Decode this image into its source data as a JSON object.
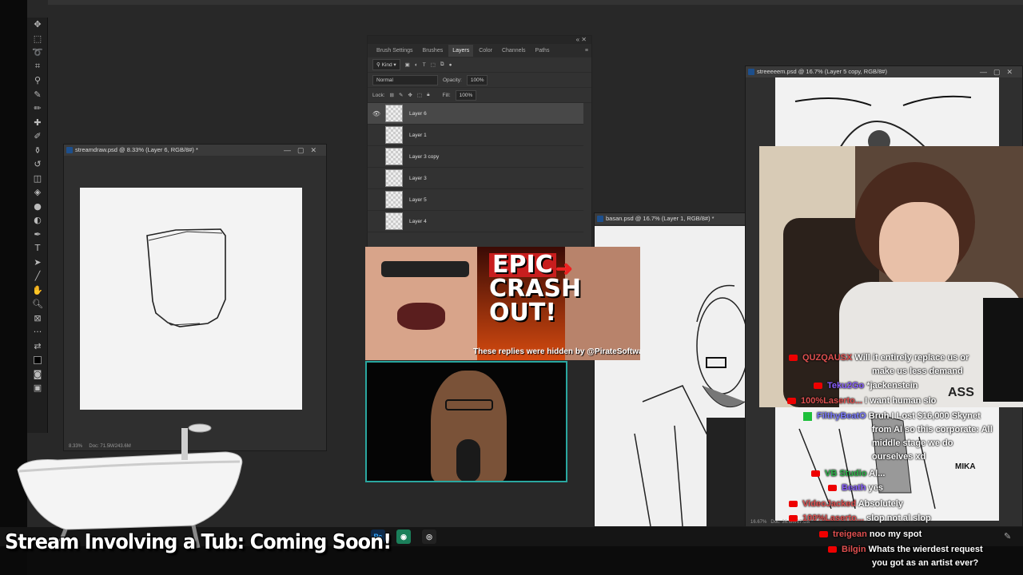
{
  "docs": {
    "left": {
      "title": "streamdraw.psd @ 8.33% (Layer 6, RGB/8#) *",
      "zoom": "8.33%",
      "size": "Doc: 71.5M/243.6M"
    },
    "middle": {
      "title": "basan.psd @ 16.7% (Layer 1, RGB/8#) *"
    },
    "right": {
      "title": "streeeeem.psd @ 16.7% (Layer 5 copy, RGB/8#)",
      "zoom": "16.67%",
      "size": "Doc: 36.6M/67.6M"
    }
  },
  "panel": {
    "tabs": [
      "Brush Settings",
      "Brushes",
      "Layers",
      "Color",
      "Channels",
      "Paths"
    ],
    "active_tab": "Layers",
    "filter_kind": "Kind",
    "blend_mode": "Normal",
    "opacity_label": "Opacity:",
    "opacity": "100%",
    "lock_label": "Lock:",
    "fill_label": "Fill:",
    "fill": "100%",
    "layers": [
      "Layer 6",
      "Layer 1",
      "Layer 3 copy",
      "Layer 3",
      "Layer 5",
      "Layer 4"
    ]
  },
  "thumbnail": {
    "line1": "EPIC",
    "line2": "CRASH",
    "line3": "OUT!",
    "caption": "These replies were hidden by @PirateSoftware"
  },
  "webcam": {
    "shirt_text": "ASS"
  },
  "chat": [
    {
      "user": "QUZQAUSX",
      "text": "Will it entirely replace us or",
      "color": "#e05050"
    },
    {
      "user": "",
      "text": "make us less demand",
      "color": "#ffffff"
    },
    {
      "user": "Teku2Go",
      "text": "*jackenstein",
      "color": "#8a60ff"
    },
    {
      "user": "100%Laserto...",
      "text": "I want human slo",
      "color": "#e05050"
    },
    {
      "user": "FilthyBeatO",
      "text": "Bruh I Lost $16,000 Skynet",
      "color": "#7a7aff"
    },
    {
      "user": "",
      "text": "from AI so this corporate: All",
      "color": "#ffffff"
    },
    {
      "user": "",
      "text": "middle stage we do",
      "color": "#ffffff"
    },
    {
      "user": "",
      "text": "ourselves xd",
      "color": "#ffffff"
    },
    {
      "user": "VB Studio",
      "text": "Al...",
      "color": "#2db24a"
    },
    {
      "user": "Beath",
      "text": "yes",
      "color": "#8a60ff"
    },
    {
      "user": "VideoJacked",
      "text": "Absolutely",
      "color": "#e05050"
    },
    {
      "user": "100%Laserto...",
      "text": "slop not al slop",
      "color": "#e05050"
    },
    {
      "user": "treigean",
      "text": "noo my spot",
      "color": "#e05050"
    },
    {
      "user": "Bilgin",
      "text": "Whats the wierdest request",
      "color": "#e05050"
    },
    {
      "user": "",
      "text": "you got as an artist ever?",
      "color": "#ffffff"
    }
  ],
  "banner": "Stream Involving a Tub: Coming Soon!",
  "taskbar": {
    "ps_label": "Ps"
  },
  "colors": {
    "accent": "#2aa7a0",
    "youtube": "#ee0000",
    "workspace": "#282828"
  }
}
